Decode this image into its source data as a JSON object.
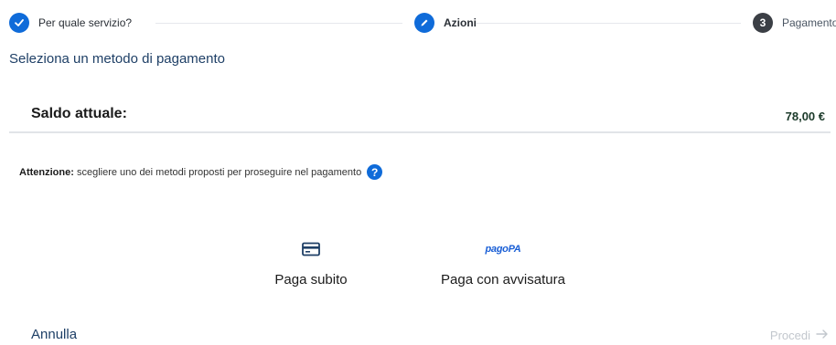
{
  "stepper": {
    "steps": [
      {
        "label": "Per quale servizio?",
        "state": "done"
      },
      {
        "label": "Azioni",
        "state": "active"
      },
      {
        "label": "Pagamento",
        "number": "3",
        "state": "pending"
      }
    ]
  },
  "section_title": "Seleziona un metodo di pagamento",
  "balance": {
    "label": "Saldo attuale:",
    "value": "78,00 €"
  },
  "notice": {
    "strong": "Attenzione:",
    "text": "scegliere uno dei metodi proposti per proseguire nel pagamento",
    "help_glyph": "?"
  },
  "methods": [
    {
      "label": "Paga subito",
      "icon": "credit-card-icon"
    },
    {
      "label": "Paga con avvisatura",
      "icon": "pagopa-logo",
      "logo_text": "pagoPA"
    }
  ],
  "actions": {
    "cancel": "Annulla",
    "proceed": "Procedi"
  },
  "colors": {
    "accent": "#0f6bd9",
    "title": "#1e3f66",
    "disabled": "#c2c7cd"
  }
}
